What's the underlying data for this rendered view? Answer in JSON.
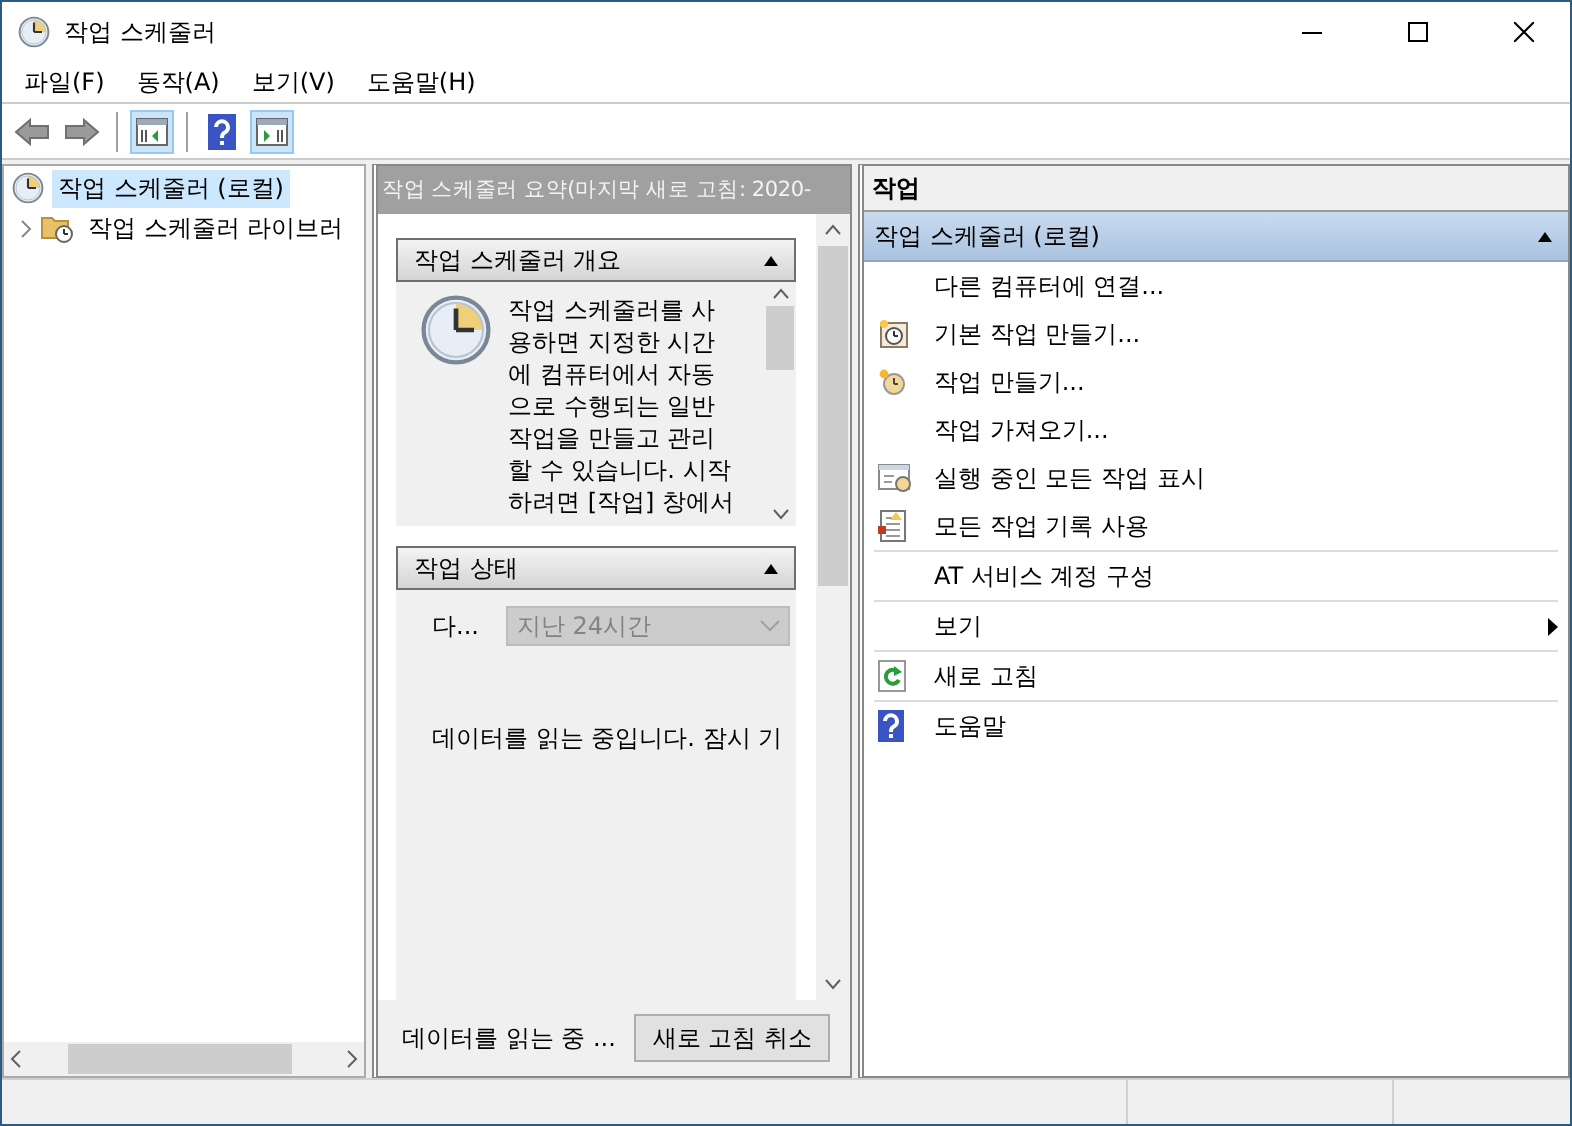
{
  "window": {
    "title": "작업 스케줄러"
  },
  "menu": [
    "파일(F)",
    "동작(A)",
    "보기(V)",
    "도움말(H)"
  ],
  "tree": [
    {
      "label": "작업 스케줄러 (로컬)",
      "selected": true,
      "children": [
        {
          "label": "작업 스케줄러 라이브러",
          "selected": false,
          "expanded": false
        }
      ]
    }
  ],
  "summary": {
    "header": "작업 스케줄러 요약(마지막 새로 고침: 2020-",
    "overview": {
      "title": "작업 스케줄러 개요",
      "expanded": true,
      "lines": [
        "작업 스케줄러를 사",
        "용하면 지정한 시간",
        "에 컴퓨터에서 자동",
        "으로 수행되는 일반",
        "작업을 만들고 관리",
        "할 수 있습니다. 시작",
        "하려면 [작업] 창에서"
      ]
    },
    "status": {
      "title": "작업 상태",
      "expanded": true,
      "filter_label": "다...",
      "filter": {
        "value": "지난 24시간",
        "disabled": true
      },
      "message": "데이터를 읽는 중입니다. 잠시 기"
    },
    "footer": "데이터를 읽는 중 ...",
    "cancel_button": "새로 고침 취소"
  },
  "actions": {
    "header": "작업",
    "group": {
      "title": "작업 스케줄러 (로컬)",
      "expanded": true
    },
    "items": [
      {
        "label": "다른 컴퓨터에 연결...",
        "kind": "plain",
        "group_start": false
      },
      {
        "label": "기본 작업 만들기...",
        "kind": "basic_task",
        "group_start": false
      },
      {
        "label": "작업 만들기...",
        "kind": "create_task",
        "group_start": false
      },
      {
        "label": "작업 가져오기...",
        "kind": "plain",
        "group_start": false
      },
      {
        "label": "실행 중인 모든 작업 표시",
        "kind": "running",
        "group_start": false
      },
      {
        "label": "모든 작업 기록 사용",
        "kind": "history",
        "group_start": false
      },
      {
        "label": "AT 서비스 계정 구성",
        "kind": "plain",
        "group_start": true
      },
      {
        "label": "보기",
        "kind": "submenu",
        "group_start": true
      },
      {
        "label": "새로 고침",
        "kind": "refresh",
        "group_start": true
      },
      {
        "label": "도움말",
        "kind": "help",
        "group_start": true
      }
    ]
  }
}
